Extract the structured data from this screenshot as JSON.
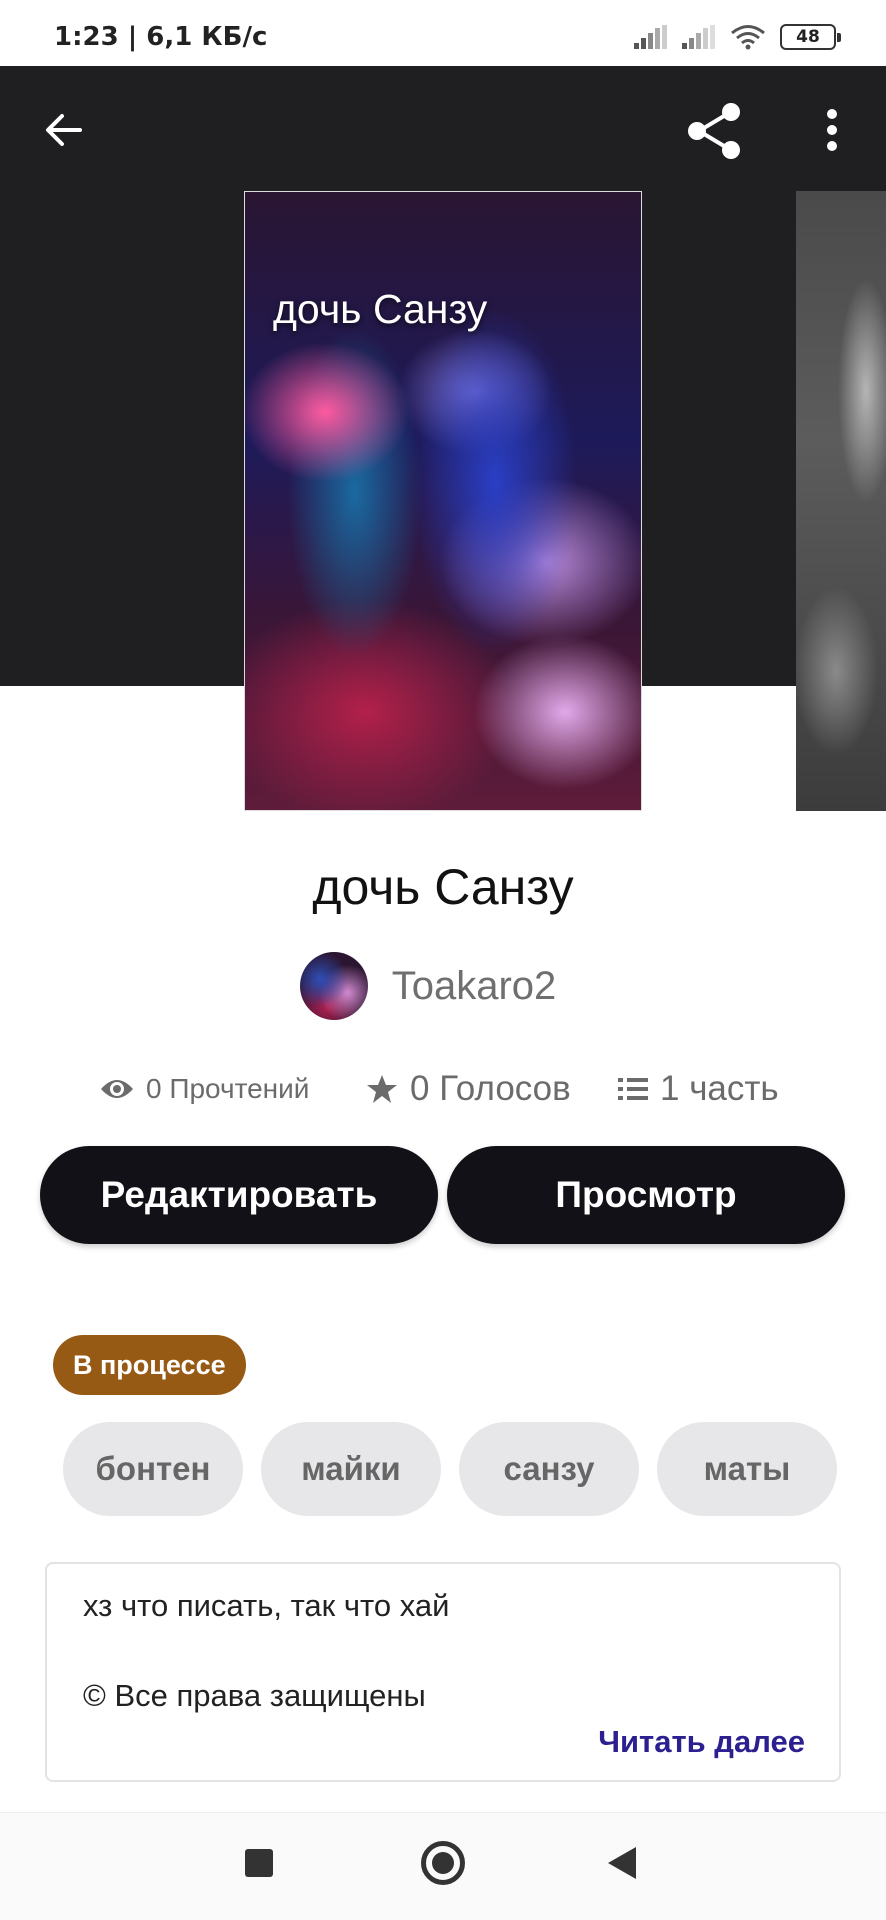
{
  "status_bar": {
    "time_speed": "1:23 | 6,1 КБ/с",
    "battery": "48"
  },
  "header": {
    "icons": [
      "back-arrow-icon",
      "share-icon",
      "more-vertical-icon"
    ]
  },
  "cover": {
    "title_text": "дочь Санзу"
  },
  "story": {
    "title": "дочь Санзу",
    "author": "Toakaro2",
    "reads": "0 Прочтений",
    "votes": "0 Голосов",
    "parts": "1 часть"
  },
  "actions": {
    "edit_label": "Редактировать",
    "view_label": "Просмотр"
  },
  "status_badge": "В процессе",
  "tags": [
    "бонтен",
    "майки",
    "санзу",
    "маты"
  ],
  "description": {
    "line1": "хз что писать, так что хай",
    "line2": "© Все права защищены",
    "read_more": "Читать далее"
  },
  "colors": {
    "header_bg": "#1f1e20",
    "button_bg": "#121117",
    "badge_bg": "#975a14",
    "tag_bg": "#e7e6e9",
    "link": "#2c1f8f"
  }
}
